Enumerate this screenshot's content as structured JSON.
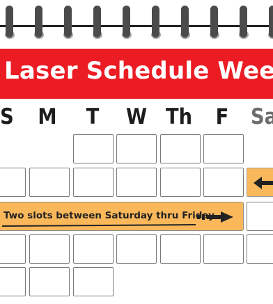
{
  "banner": {
    "title": "Laser Schedule Week"
  },
  "days": [
    "S",
    "M",
    "T",
    "W",
    "Th",
    "F",
    "Sa"
  ],
  "slot_note": {
    "text": "Two slots between Saturday thru Friday"
  },
  "colors": {
    "banner_red": "#ec1c24",
    "slot_orange": "#fbb85b",
    "ring_dark": "#4b4b4b"
  },
  "icons": {
    "right_arrow": "double-arrow-right-icon",
    "left_arrow": "arrow-left-icon"
  }
}
